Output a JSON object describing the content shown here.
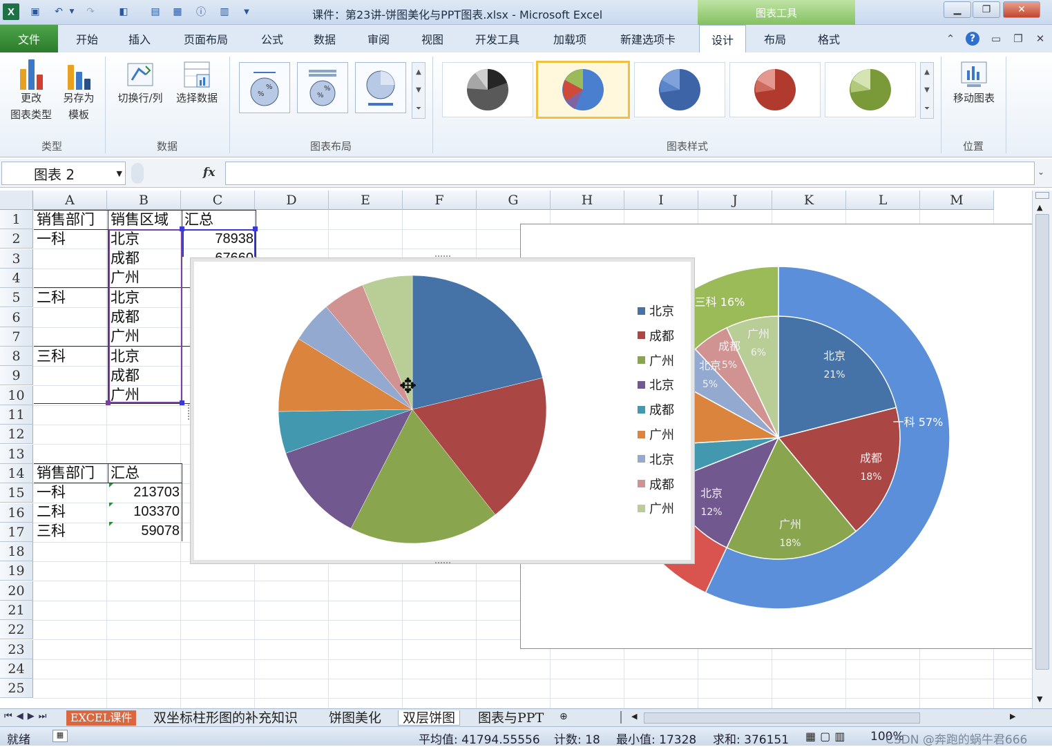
{
  "window": {
    "title": "课件：第23讲-饼图美化与PPT图表.xlsx - Microsoft Excel",
    "contextual_header": "图表工具"
  },
  "tabs": [
    "文件",
    "开始",
    "插入",
    "页面布局",
    "公式",
    "数据",
    "审阅",
    "视图",
    "开发工具",
    "加载项",
    "新建选项卡",
    "设计",
    "布局",
    "格式"
  ],
  "active_tab": "设计",
  "ribbon": {
    "type_group": {
      "label": "类型",
      "change_type_line1": "更改",
      "change_type_line2": "图表类型",
      "save_template_line1": "另存为",
      "save_template_line2": "模板"
    },
    "data_group": {
      "label": "数据",
      "switch_row_col": "切换行/列",
      "select_data": "选择数据"
    },
    "layout_group": {
      "label": "图表布局"
    },
    "style_group": {
      "label": "图表样式"
    },
    "location_group": {
      "label": "位置",
      "move_chart": "移动图表"
    }
  },
  "formula_bar": {
    "name_box": "图表 2",
    "fx": "fx",
    "formula": ""
  },
  "columns": [
    "A",
    "B",
    "C",
    "D",
    "E",
    "F",
    "G",
    "H",
    "I",
    "J",
    "K",
    "L",
    "M"
  ],
  "rows": [
    "1",
    "2",
    "3",
    "4",
    "5",
    "6",
    "7",
    "8",
    "9",
    "10",
    "11",
    "12",
    "13",
    "14",
    "15",
    "16",
    "17",
    "18",
    "19",
    "20",
    "21",
    "22",
    "23",
    "24",
    "25"
  ],
  "table1": {
    "header": [
      "销售部门",
      "销售区域",
      "汇总"
    ],
    "depts": [
      "一科",
      "二科",
      "三科"
    ],
    "regions": [
      "北京",
      "成都",
      "广州",
      "北京",
      "成都",
      "广州",
      "北京",
      "成都",
      "广州"
    ],
    "values_visible": [
      "78938",
      "67660"
    ]
  },
  "table2": {
    "header": [
      "销售部门",
      "汇总"
    ],
    "rows": [
      {
        "dept": "一科",
        "total": "213703"
      },
      {
        "dept": "二科",
        "total": "103370"
      },
      {
        "dept": "三科",
        "total": "59078"
      }
    ]
  },
  "chart_data": [
    {
      "type": "pie",
      "categories": [
        "北京",
        "成都",
        "广州",
        "北京",
        "成都",
        "广州",
        "北京",
        "成都",
        "广州"
      ],
      "values": [
        21,
        18,
        18,
        12,
        5,
        9,
        5,
        5,
        6
      ],
      "colors": [
        "#4572a7",
        "#aa4643",
        "#89a54e",
        "#71588f",
        "#4198af",
        "#db843d",
        "#93a9cf",
        "#d19392",
        "#b9cd96"
      ],
      "legend": "right"
    },
    {
      "type": "pie",
      "subtype": "doughnut-pie",
      "outer_ring": {
        "labels": [
          "一科 57%",
          "三科 16%"
        ],
        "colors": [
          "#5b8fd9",
          "#9bbb59",
          "#d9534f"
        ]
      },
      "inner_labels": [
        {
          "name": "北京",
          "pct": "21%"
        },
        {
          "name": "成都",
          "pct": "18%"
        },
        {
          "name": "广州",
          "pct": "18%"
        },
        {
          "name": "北京",
          "pct": "12%"
        },
        {
          "name": "北京",
          "pct": "5%"
        },
        {
          "name": "成都",
          "pct": "5%"
        },
        {
          "name": "广州",
          "pct": "6%"
        }
      ]
    }
  ],
  "sheets": [
    "EXCEL课件",
    "双坐标柱形图的补充知识",
    "饼图美化",
    "双层饼图",
    "图表与PPT"
  ],
  "active_sheet": "双层饼图",
  "status": {
    "ready": "就绪",
    "average": "平均值: 41794.55556",
    "count": "计数: 18",
    "min": "最小值: 17328",
    "sum": "求和: 376151",
    "zoom": "100%"
  },
  "watermark": "CSDN @奔跑的蜗牛君666"
}
